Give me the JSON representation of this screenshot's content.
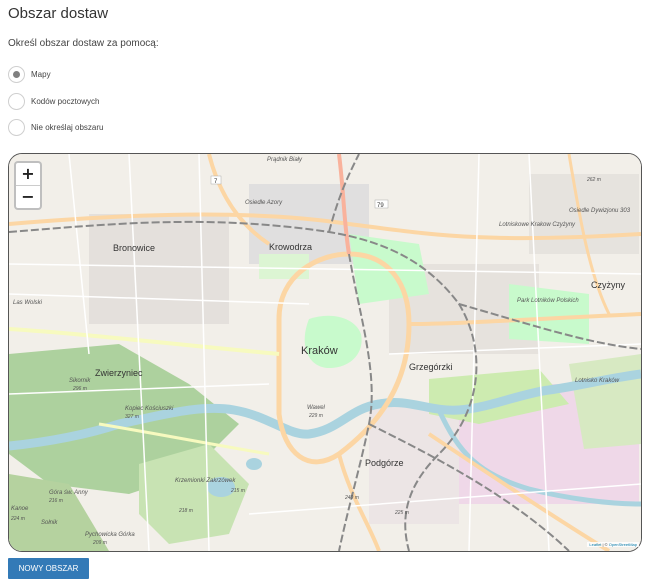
{
  "section_title": "Obszar dostaw",
  "subtitle": "Określ obszar dostaw za pomocą:",
  "options": [
    {
      "label": "Mapy",
      "checked": true
    },
    {
      "label": "Kodów pocztowych",
      "checked": false
    },
    {
      "label": "Nie określaj obszaru",
      "checked": false
    }
  ],
  "map": {
    "zoom_in": "+",
    "zoom_out": "−",
    "attribution_leaflet": "Leaflet",
    "attribution_sep": " | © ",
    "attribution_osm": "OpenStreetMap",
    "places": [
      {
        "name": "Bronowice"
      },
      {
        "name": "Krowodrza"
      },
      {
        "name": "Kraków"
      },
      {
        "name": "Grzegórzki"
      },
      {
        "name": "Czyżyny"
      },
      {
        "name": "Zwierzyniec"
      },
      {
        "name": "Podgórze"
      },
      {
        "name": "Park Lotników Polskich"
      },
      {
        "name": "Lotniskowe Krakow Czyżyny"
      },
      {
        "name": "Wawel"
      },
      {
        "name": "Kopiec Kościuszki"
      },
      {
        "name": "Sikornik"
      },
      {
        "name": "Osiedle Azory"
      },
      {
        "name": "Osiedle Dywizjonu 303"
      },
      {
        "name": "Krzemionki Zakrzówek"
      },
      {
        "name": "Góra św. Anny"
      },
      {
        "name": "Pychowicka Górka"
      },
      {
        "name": "Sołnik"
      },
      {
        "name": "Kanoe"
      },
      {
        "name": "Las Wolski"
      },
      {
        "name": "Lotnisko Kraków"
      },
      {
        "name": "Prądnik Biały"
      }
    ],
    "road_numbers": [
      "79",
      "7"
    ],
    "elevations": [
      "262 m",
      "296 m",
      "327 m",
      "229 m",
      "215 m",
      "218 m",
      "216 m",
      "209 m",
      "240 m",
      "224 m",
      "225 m"
    ]
  },
  "new_area_button": "Nowy obszar",
  "colors": {
    "accent": "#337ab7",
    "map_bg": "#f2efe9",
    "water": "#aad3df",
    "park": "#c8facc",
    "forest": "#add19e",
    "major_road": "#fcd6a4",
    "railway": "#888888"
  }
}
